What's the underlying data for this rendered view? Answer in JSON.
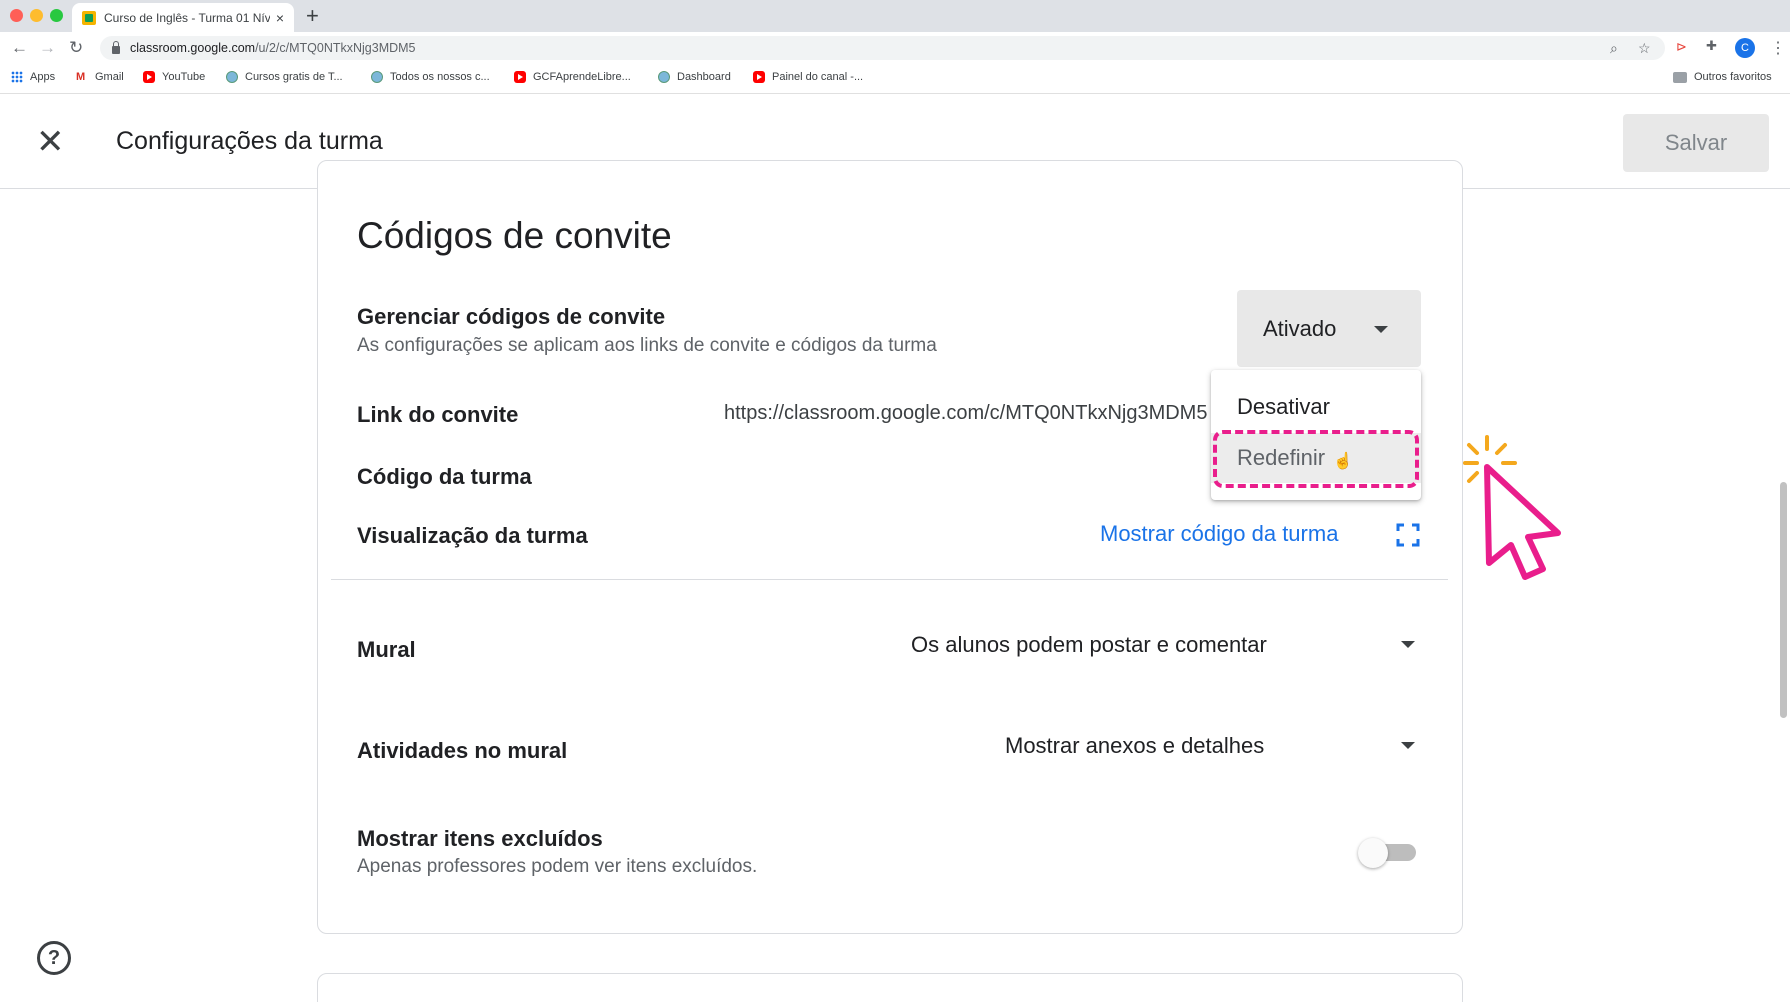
{
  "browser": {
    "tab_title": "Curso de Inglês - Turma 01 Nív",
    "tab_close": "×",
    "new_tab": "+",
    "url_host": "classroom.google.com",
    "url_path": "/u/2/c/MTQ0NTkxNjg3MDM5",
    "profile_initial": "C",
    "nav": {
      "back": "←",
      "forward": "→",
      "reload": "↻"
    },
    "bookmarks": [
      {
        "label": "Apps",
        "icon": "apps-grid-icon"
      },
      {
        "label": "Gmail",
        "icon": "gmail-icon"
      },
      {
        "label": "YouTube",
        "icon": "youtube-icon"
      },
      {
        "label": "Cursos gratis de T...",
        "icon": "globe-icon"
      },
      {
        "label": "Todos os nossos c...",
        "icon": "globe-icon"
      },
      {
        "label": "GCFAprendeLibre...",
        "icon": "youtube-icon"
      },
      {
        "label": "Dashboard",
        "icon": "globe-icon"
      },
      {
        "label": "Painel do canal -...",
        "icon": "youtube-icon"
      }
    ],
    "other_bookmarks": "Outros favoritos"
  },
  "header": {
    "title": "Configurações da turma",
    "save_label": "Salvar",
    "close_symbol": "✕"
  },
  "invite": {
    "section_title": "Códigos de convite",
    "manage_label": "Gerenciar códigos de convite",
    "manage_desc": "As configurações se aplicam aos links de convite e códigos da turma",
    "status_value": "Ativado",
    "menu": [
      "Desativar",
      "Redefinir"
    ],
    "link_label": "Link do convite",
    "link_value": "https://classroom.google.com/c/MTQ0NTkxNjg3MDM5",
    "code_label": "Código da turma",
    "preview_label": "Visualização da turma",
    "show_code_label": "Mostrar código da turma"
  },
  "settings": {
    "mural_label": "Mural",
    "mural_value": "Os alunos podem postar e comentar",
    "activities_label": "Atividades no mural",
    "activities_value": "Mostrar anexos e detalhes",
    "deleted_label": "Mostrar itens excluídos",
    "deleted_desc": "Apenas professores podem ver itens excluídos.",
    "deleted_enabled": false
  },
  "colors": {
    "accent_link": "#1a73e8",
    "highlight_annotation": "#e91e8c",
    "sparkle": "#f4a81d"
  }
}
